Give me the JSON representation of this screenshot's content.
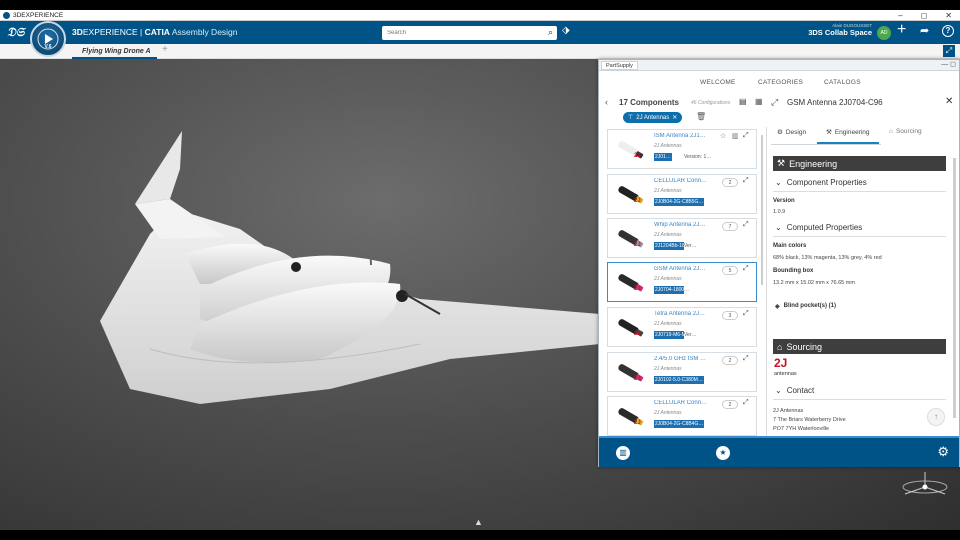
{
  "window": {
    "title": "3DEXPERIENCE",
    "controls": [
      "–",
      "◻",
      "✕"
    ]
  },
  "appbar": {
    "brand_a": "3D",
    "brand_b": "EXPERIENCE | ",
    "brand_c": "CATIA",
    "brand_d": " Assembly Design",
    "compass_version": "V.6",
    "search_placeholder": "Search",
    "user_name": "Alain DUGOUSSET",
    "space": "3DS Collab Space",
    "avatar": "AD"
  },
  "doc": {
    "tab": "Flying Wing Drone A",
    "add": "+"
  },
  "panel": {
    "title": "PartSupply",
    "nav": [
      "WELCOME",
      "CATEGORIES",
      "CATALOGS"
    ],
    "list": {
      "count": "17 Components",
      "configs": "46 Configurations",
      "filter_chip": "2J Antennas",
      "cards": [
        {
          "name": "ISM Antenna 2J1…",
          "brand": "2J Antennas",
          "pn": "2J01…",
          "ver": "Version: 1…",
          "count": ""
        },
        {
          "name": "CELLULAR Conn…",
          "brand": "2J Antennas",
          "pn": "2J0B04-2G-C8B5G…",
          "ver": "",
          "count": "2"
        },
        {
          "name": "Whip Antenna 2J…",
          "brand": "2J Antennas",
          "pn": "2J1204Bb-1800",
          "ver": "Ver…",
          "count": "7"
        },
        {
          "name": "GSM Antenna 2J…",
          "brand": "2J Antennas",
          "pn": "2J0704-1800-C96",
          "ver": "…",
          "count": "5"
        },
        {
          "name": "Tetra Antenna 2J…",
          "brand": "2J Antennas",
          "pn": "2J0719-M6-M5",
          "ver": "Ver…",
          "count": "3"
        },
        {
          "name": "2.4/5.0 GHz ISM …",
          "brand": "2J Antennas",
          "pn": "2J0102-5.0-C380M…",
          "ver": "",
          "count": "2"
        },
        {
          "name": "CELLULAR Conn…",
          "brand": "2J Antennas",
          "pn": "2J0B04-2G-C8B4G…",
          "ver": "",
          "count": "2"
        }
      ],
      "logo_text": "2J"
    },
    "detail": {
      "title": "GSM Antenna 2J0704-C96",
      "tabs": [
        "Design",
        "Engineering",
        "Sourcing"
      ],
      "engineering": {
        "heading": "Engineering",
        "component_properties": "Component Properties",
        "version_label": "Version",
        "version_value": "1.0.9",
        "computed_properties": "Computed Properties",
        "colors_label": "Main colors",
        "colors_value": "68% black, 13% magenta, 13% grey, 4% red",
        "bbox_label": "Bounding box",
        "bbox_value": "13.2 mm x 15.02 mm x 76.65 mm",
        "blind_pockets": "Blind pocket(s) (1)"
      },
      "sourcing": {
        "heading": "Sourcing",
        "logo_mark": "2J",
        "logo_word": "antennas",
        "contact": "Contact",
        "address": [
          "2J Antennas",
          "7 The Briars Waterberry Drive",
          "PO7 7YH Waterlooville",
          "…"
        ]
      }
    }
  },
  "colors": {
    "brand_blue": "#005386",
    "accent": "#1b7fc4",
    "logo_red": "#c8102e"
  }
}
